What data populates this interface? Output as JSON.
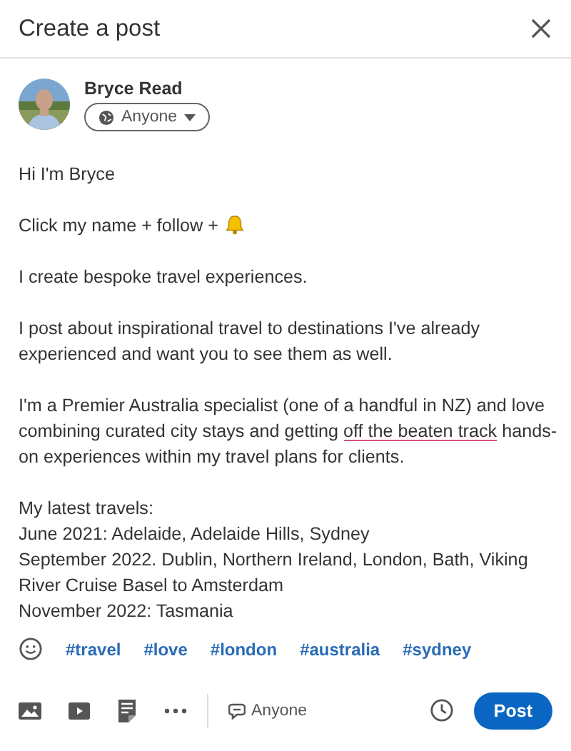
{
  "dialog": {
    "title": "Create a post"
  },
  "author": {
    "name": "Bryce Read",
    "audience": "Anyone"
  },
  "body": [
    {
      "kind": "plain",
      "parts": [
        {
          "text": "Hi I'm Bryce",
          "flagged": false
        }
      ]
    },
    {
      "kind": "bell",
      "parts": [
        {
          "text": "Click my name + follow +",
          "flagged": false
        }
      ]
    },
    {
      "kind": "plain",
      "parts": [
        {
          "text": "I create bespoke travel experiences.",
          "flagged": false
        }
      ]
    },
    {
      "kind": "plain",
      "parts": [
        {
          "text": "I post about inspirational travel to destinations I've already experienced and want you to see them as well.",
          "flagged": false
        }
      ]
    },
    {
      "kind": "plain",
      "parts": [
        {
          "text": "I'm a Premier Australia specialist (one of a handful in NZ) and love combining curated city stays and getting ",
          "flagged": false
        },
        {
          "text": "off the beaten track",
          "flagged": true
        },
        {
          "text": " hands-on experiences within my travel plans for clients.",
          "flagged": false
        }
      ]
    },
    {
      "kind": "plain",
      "parts": [
        {
          "text": "My latest travels:\nJune 2021: Adelaide, Adelaide Hills, Sydney\nSeptember 2022. Dublin, Northern Ireland, London, Bath, Viking River Cruise Basel to Amsterdam\nNovember 2022: Tasmania",
          "flagged": false
        }
      ]
    }
  ],
  "hashtags": [
    "#travel",
    "#love",
    "#london",
    "#australia",
    "#sydney"
  ],
  "toolbar": {
    "comment_audience": "Anyone",
    "post_button": "Post"
  }
}
